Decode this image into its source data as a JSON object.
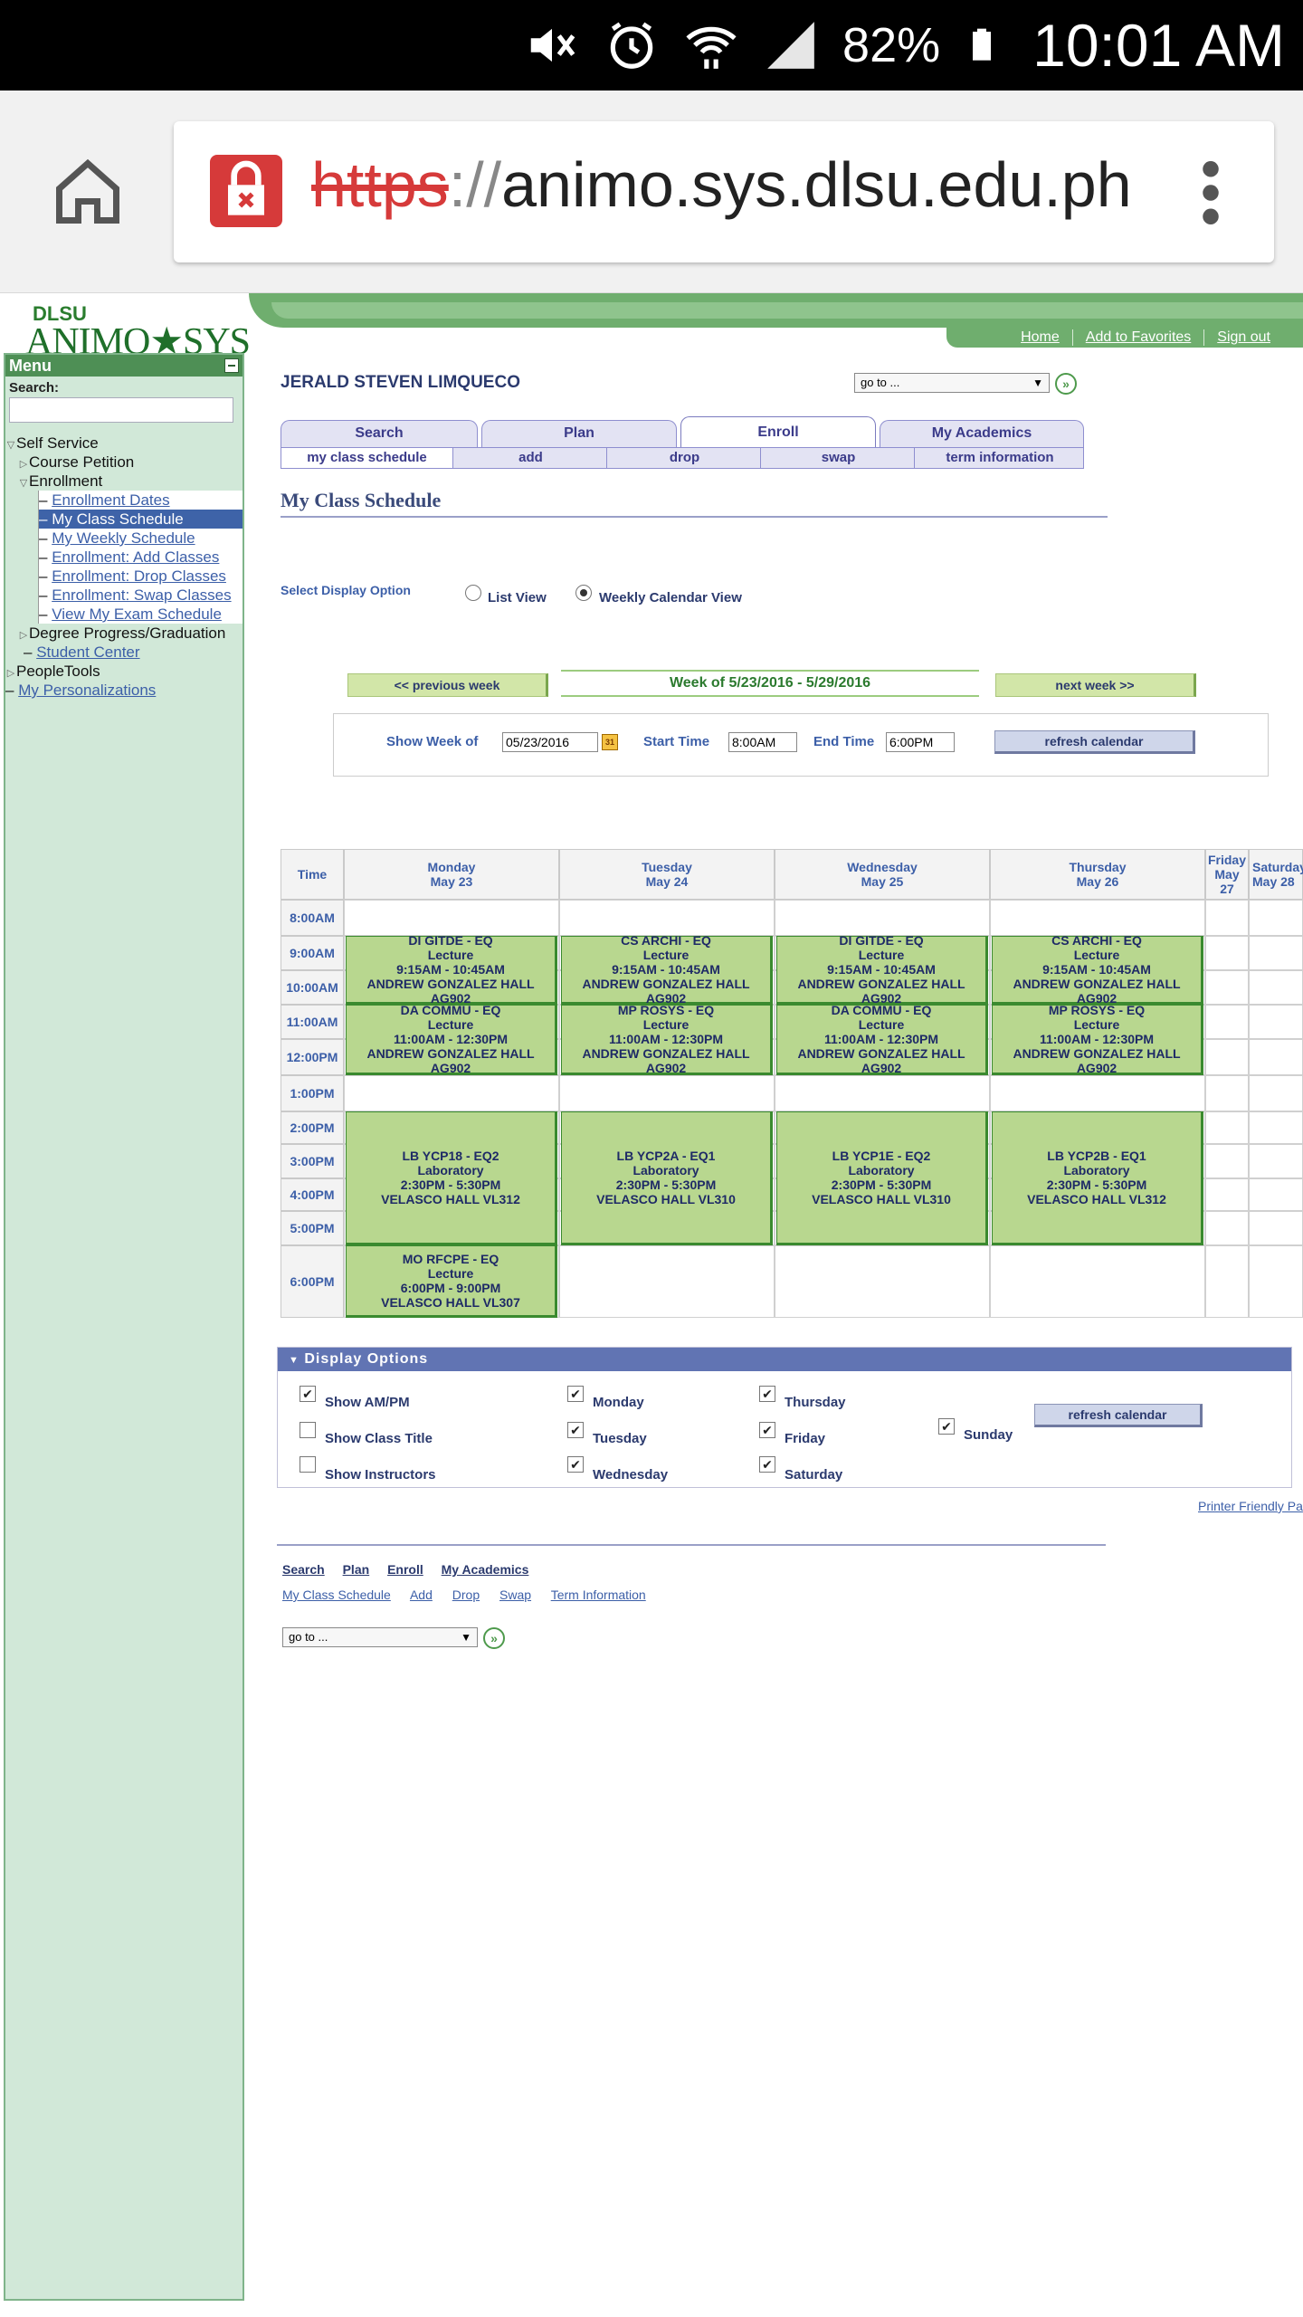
{
  "statusbar": {
    "battery_pct": "82%",
    "time": "10:01 AM",
    "icons": [
      "mute-icon",
      "alarm-icon",
      "wifi-icon",
      "signal-icon",
      "battery-icon"
    ]
  },
  "browser": {
    "url_scheme": "https",
    "url_sep": "://",
    "url_host": "animo.sys.dlsu.edu.ph"
  },
  "banner": {
    "logo_top": "DLSU",
    "logo_main": "ANIMO★SYS",
    "links": [
      "Home",
      "Add to Favorites",
      "Sign out"
    ]
  },
  "menu": {
    "title": "Menu",
    "search_label": "Search:",
    "items": [
      {
        "label": "Self Service"
      },
      {
        "label": "Course Petition"
      },
      {
        "label": "Enrollment"
      },
      {
        "label": "Enrollment Dates"
      },
      {
        "label": "My Class Schedule"
      },
      {
        "label": "My Weekly Schedule"
      },
      {
        "label": "Enrollment: Add Classes"
      },
      {
        "label": "Enrollment: Drop Classes"
      },
      {
        "label": "Enrollment: Swap Classes"
      },
      {
        "label": "View My Exam Schedule"
      },
      {
        "label": "Degree Progress/Graduation"
      },
      {
        "label": "Student Center"
      },
      {
        "label": "PeopleTools"
      },
      {
        "label": "My Personalizations"
      }
    ]
  },
  "main": {
    "student_name": "JERALD STEVEN LIMQUECO",
    "goto": "go to ...",
    "tabs": [
      "Search",
      "Plan",
      "Enroll",
      "My Academics"
    ],
    "subtabs": [
      "my class schedule",
      "add",
      "drop",
      "swap",
      "term information"
    ],
    "page_title": "My Class Schedule",
    "display_option_label": "Select Display Option",
    "radio_list": "List View",
    "radio_weekly": "Weekly Calendar View",
    "prev_week": "<< previous week",
    "week_title": "Week of 5/23/2016 - 5/29/2016",
    "next_week": "next week >>",
    "show_week_label": "Show Week of",
    "show_week_value": "05/23/2016",
    "start_time_label": "Start Time",
    "start_time_value": "8:00AM",
    "end_time_label": "End Time",
    "end_time_value": "6:00PM",
    "refresh": "refresh calendar"
  },
  "calendar": {
    "time_header": "Time",
    "days": [
      {
        "name": "Monday",
        "date": "May 23"
      },
      {
        "name": "Tuesday",
        "date": "May 24"
      },
      {
        "name": "Wednesday",
        "date": "May 25"
      },
      {
        "name": "Thursday",
        "date": "May 26"
      },
      {
        "name": "Friday",
        "date": "May 27"
      },
      {
        "name": "Saturday",
        "date": "May 28"
      }
    ],
    "times": [
      "8:00AM",
      "9:00AM",
      "10:00AM",
      "11:00AM",
      "12:00PM",
      "1:00PM",
      "2:00PM",
      "3:00PM",
      "4:00PM",
      "5:00PM",
      "6:00PM"
    ],
    "events": [
      {
        "day": 0,
        "lines": [
          "DI GITDE - EQ",
          "Lecture",
          "9:15AM - 10:45AM",
          "ANDREW GONZALEZ HALL AG902"
        ]
      },
      {
        "day": 1,
        "lines": [
          "CS ARCHI - EQ",
          "Lecture",
          "9:15AM - 10:45AM",
          "ANDREW GONZALEZ HALL AG902"
        ]
      },
      {
        "day": 2,
        "lines": [
          "DI GITDE - EQ",
          "Lecture",
          "9:15AM - 10:45AM",
          "ANDREW GONZALEZ HALL AG902"
        ]
      },
      {
        "day": 3,
        "lines": [
          "CS ARCHI - EQ",
          "Lecture",
          "9:15AM - 10:45AM",
          "ANDREW GONZALEZ HALL AG902"
        ]
      },
      {
        "day": 0,
        "lines": [
          "DA COMMU - EQ",
          "Lecture",
          "11:00AM - 12:30PM",
          "ANDREW GONZALEZ HALL AG902"
        ]
      },
      {
        "day": 1,
        "lines": [
          "MP ROSYS - EQ",
          "Lecture",
          "11:00AM - 12:30PM",
          "ANDREW GONZALEZ HALL AG902"
        ]
      },
      {
        "day": 2,
        "lines": [
          "DA COMMU - EQ",
          "Lecture",
          "11:00AM - 12:30PM",
          "ANDREW GONZALEZ HALL AG902"
        ]
      },
      {
        "day": 3,
        "lines": [
          "MP ROSYS - EQ",
          "Lecture",
          "11:00AM - 12:30PM",
          "ANDREW GONZALEZ HALL AG902"
        ]
      },
      {
        "day": 0,
        "lines": [
          "LB YCP18 - EQ2",
          "Laboratory",
          "2:30PM - 5:30PM",
          "VELASCO HALL VL312"
        ]
      },
      {
        "day": 1,
        "lines": [
          "LB YCP2A - EQ1",
          "Laboratory",
          "2:30PM - 5:30PM",
          "VELASCO HALL VL310"
        ]
      },
      {
        "day": 2,
        "lines": [
          "LB YCP1E - EQ2",
          "Laboratory",
          "2:30PM - 5:30PM",
          "VELASCO HALL VL310"
        ]
      },
      {
        "day": 3,
        "lines": [
          "LB YCP2B - EQ1",
          "Laboratory",
          "2:30PM - 5:30PM",
          "VELASCO HALL VL312"
        ]
      },
      {
        "day": 0,
        "lines": [
          "MO RFCPE - EQ",
          "Lecture",
          "6:00PM - 9:00PM",
          "VELASCO HALL VL307"
        ]
      }
    ]
  },
  "display_options": {
    "title": "Display Options",
    "checks": [
      {
        "label": "Show AM/PM",
        "checked": true
      },
      {
        "label": "Show Class Title",
        "checked": false
      },
      {
        "label": "Show Instructors",
        "checked": false
      },
      {
        "label": "Monday",
        "checked": true
      },
      {
        "label": "Tuesday",
        "checked": true
      },
      {
        "label": "Wednesday",
        "checked": true
      },
      {
        "label": "Thursday",
        "checked": true
      },
      {
        "label": "Friday",
        "checked": true
      },
      {
        "label": "Saturday",
        "checked": true
      },
      {
        "label": "Sunday",
        "checked": true
      }
    ],
    "refresh": "refresh calendar"
  },
  "footer": {
    "printer_link": "Printer Friendly Pa",
    "links": [
      "Search",
      "Plan",
      "Enroll",
      "My Academics"
    ],
    "sublinks": [
      "My Class Schedule",
      "Add",
      "Drop",
      "Swap",
      "Term Information"
    ],
    "goto": "go to ..."
  }
}
